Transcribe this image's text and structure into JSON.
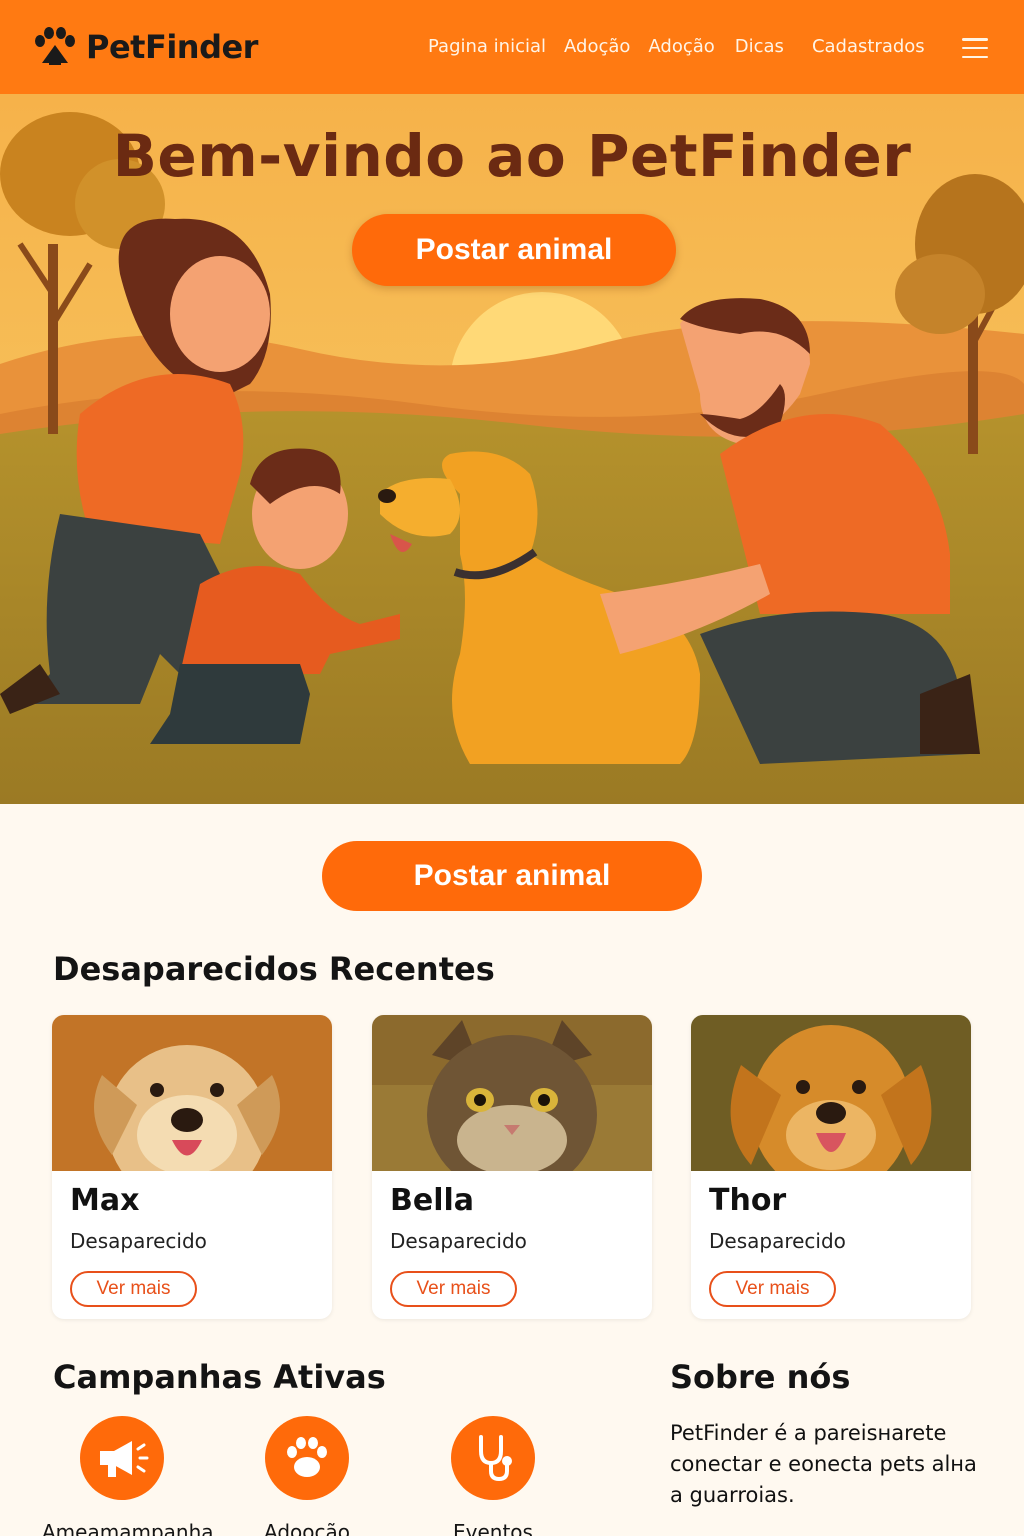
{
  "app": {
    "name": "PetFinder"
  },
  "nav": {
    "items": [
      "Pagina inicial",
      "Adoção",
      "Adoção",
      "Dicas",
      "Cadastrados"
    ]
  },
  "hero": {
    "title": "Bem-vindo ao PetFinder",
    "cta": "Postar animal"
  },
  "main_cta": "Postar animal",
  "missing": {
    "title": "Desaparecidos Recentes",
    "cards": [
      {
        "name": "Max",
        "status": "Desaparecido",
        "action": "Ver mais"
      },
      {
        "name": "Bella",
        "status": "Desaparecido",
        "action": "Ver mais"
      },
      {
        "name": "Thor",
        "status": "Desaparecido",
        "action": "Ver mais"
      }
    ]
  },
  "campaigns": {
    "title": "Campanhas Ativas",
    "items": [
      {
        "label": "Ameamampanha",
        "icon": "megaphone-icon"
      },
      {
        "label": "Adoocão",
        "icon": "paw-icon"
      },
      {
        "label": "Eventos",
        "icon": "stethoscope-icon"
      }
    ]
  },
  "about": {
    "title": "Sobre nós",
    "text": "PetFinder é a pareisнarete conectar e eonecta pets alнa a guarroias."
  },
  "colors": {
    "accent": "#ff6a0a",
    "header": "#ff7a12",
    "title_brown": "#6b2a12"
  }
}
